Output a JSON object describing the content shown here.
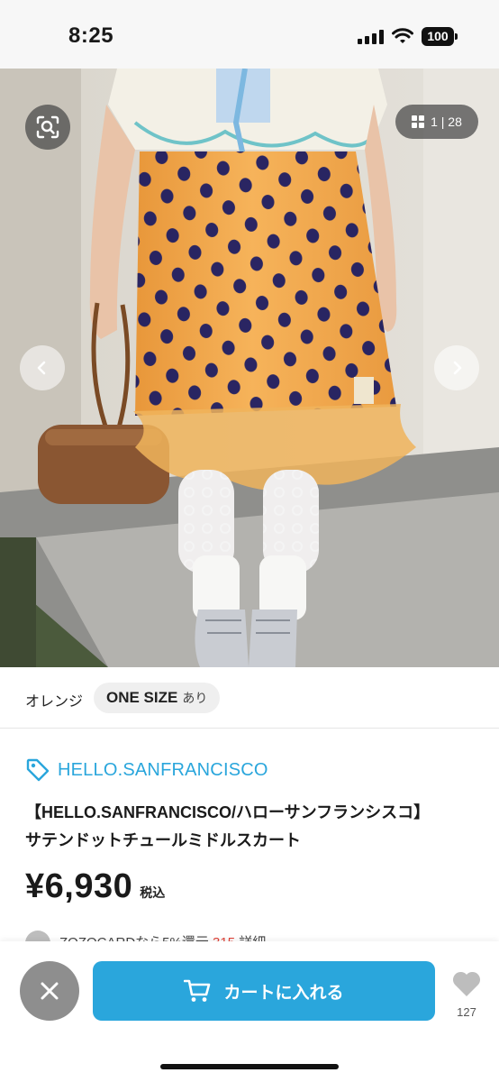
{
  "status_bar": {
    "time": "8:25",
    "battery": "100"
  },
  "image_gallery": {
    "counter": "1 | 28",
    "icons": [
      "image-search-icon",
      "grid-icon",
      "chevron-left-icon",
      "chevron-right-icon"
    ]
  },
  "variant": {
    "color": "オレンジ",
    "size": "ONE SIZE",
    "availability": "あり"
  },
  "product": {
    "brand": "HELLO.SANFRANCISCO",
    "title_line1": "【HELLO.SANFRANCISCO/ハローサンフランシスコ】",
    "title_line2": "サテンドットチュールミドルスカート",
    "price": "¥6,930",
    "tax_label": "税込"
  },
  "coupon": {
    "text": "ZOZOCARDなら5%還元",
    "points": "315",
    "link": "詳細"
  },
  "actions": {
    "cart_label": "カートに入れる",
    "favorite_count": "127"
  },
  "colors": {
    "accent": "#2aa6dc",
    "close_button": "#8e8e8e",
    "skirt_orange": "#f2a443",
    "dot_navy": "#1f1e63"
  }
}
